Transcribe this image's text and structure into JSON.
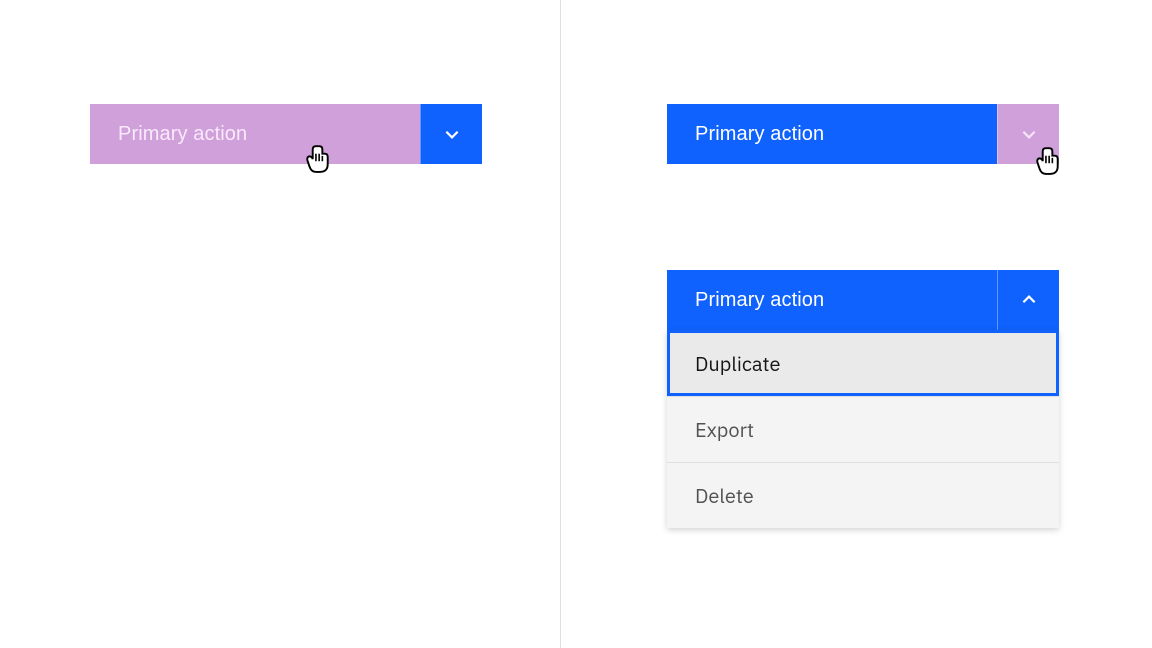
{
  "colors": {
    "brand_blue": "#0f62fe",
    "highlight_purple": "#d0a0db",
    "menu_bg": "#f4f4f4",
    "text_on_blue": "#ffffff",
    "text_on_purple": "#f9e9fb",
    "menu_text": "#525252",
    "menu_text_focused": "#161616"
  },
  "left": {
    "primary_label": "Primary action"
  },
  "right": {
    "closed": {
      "primary_label": "Primary action"
    },
    "open": {
      "primary_label": "Primary action",
      "menu_items": [
        {
          "label": "Duplicate",
          "focused": true
        },
        {
          "label": "Export",
          "focused": false
        },
        {
          "label": "Delete",
          "focused": false
        }
      ]
    }
  }
}
